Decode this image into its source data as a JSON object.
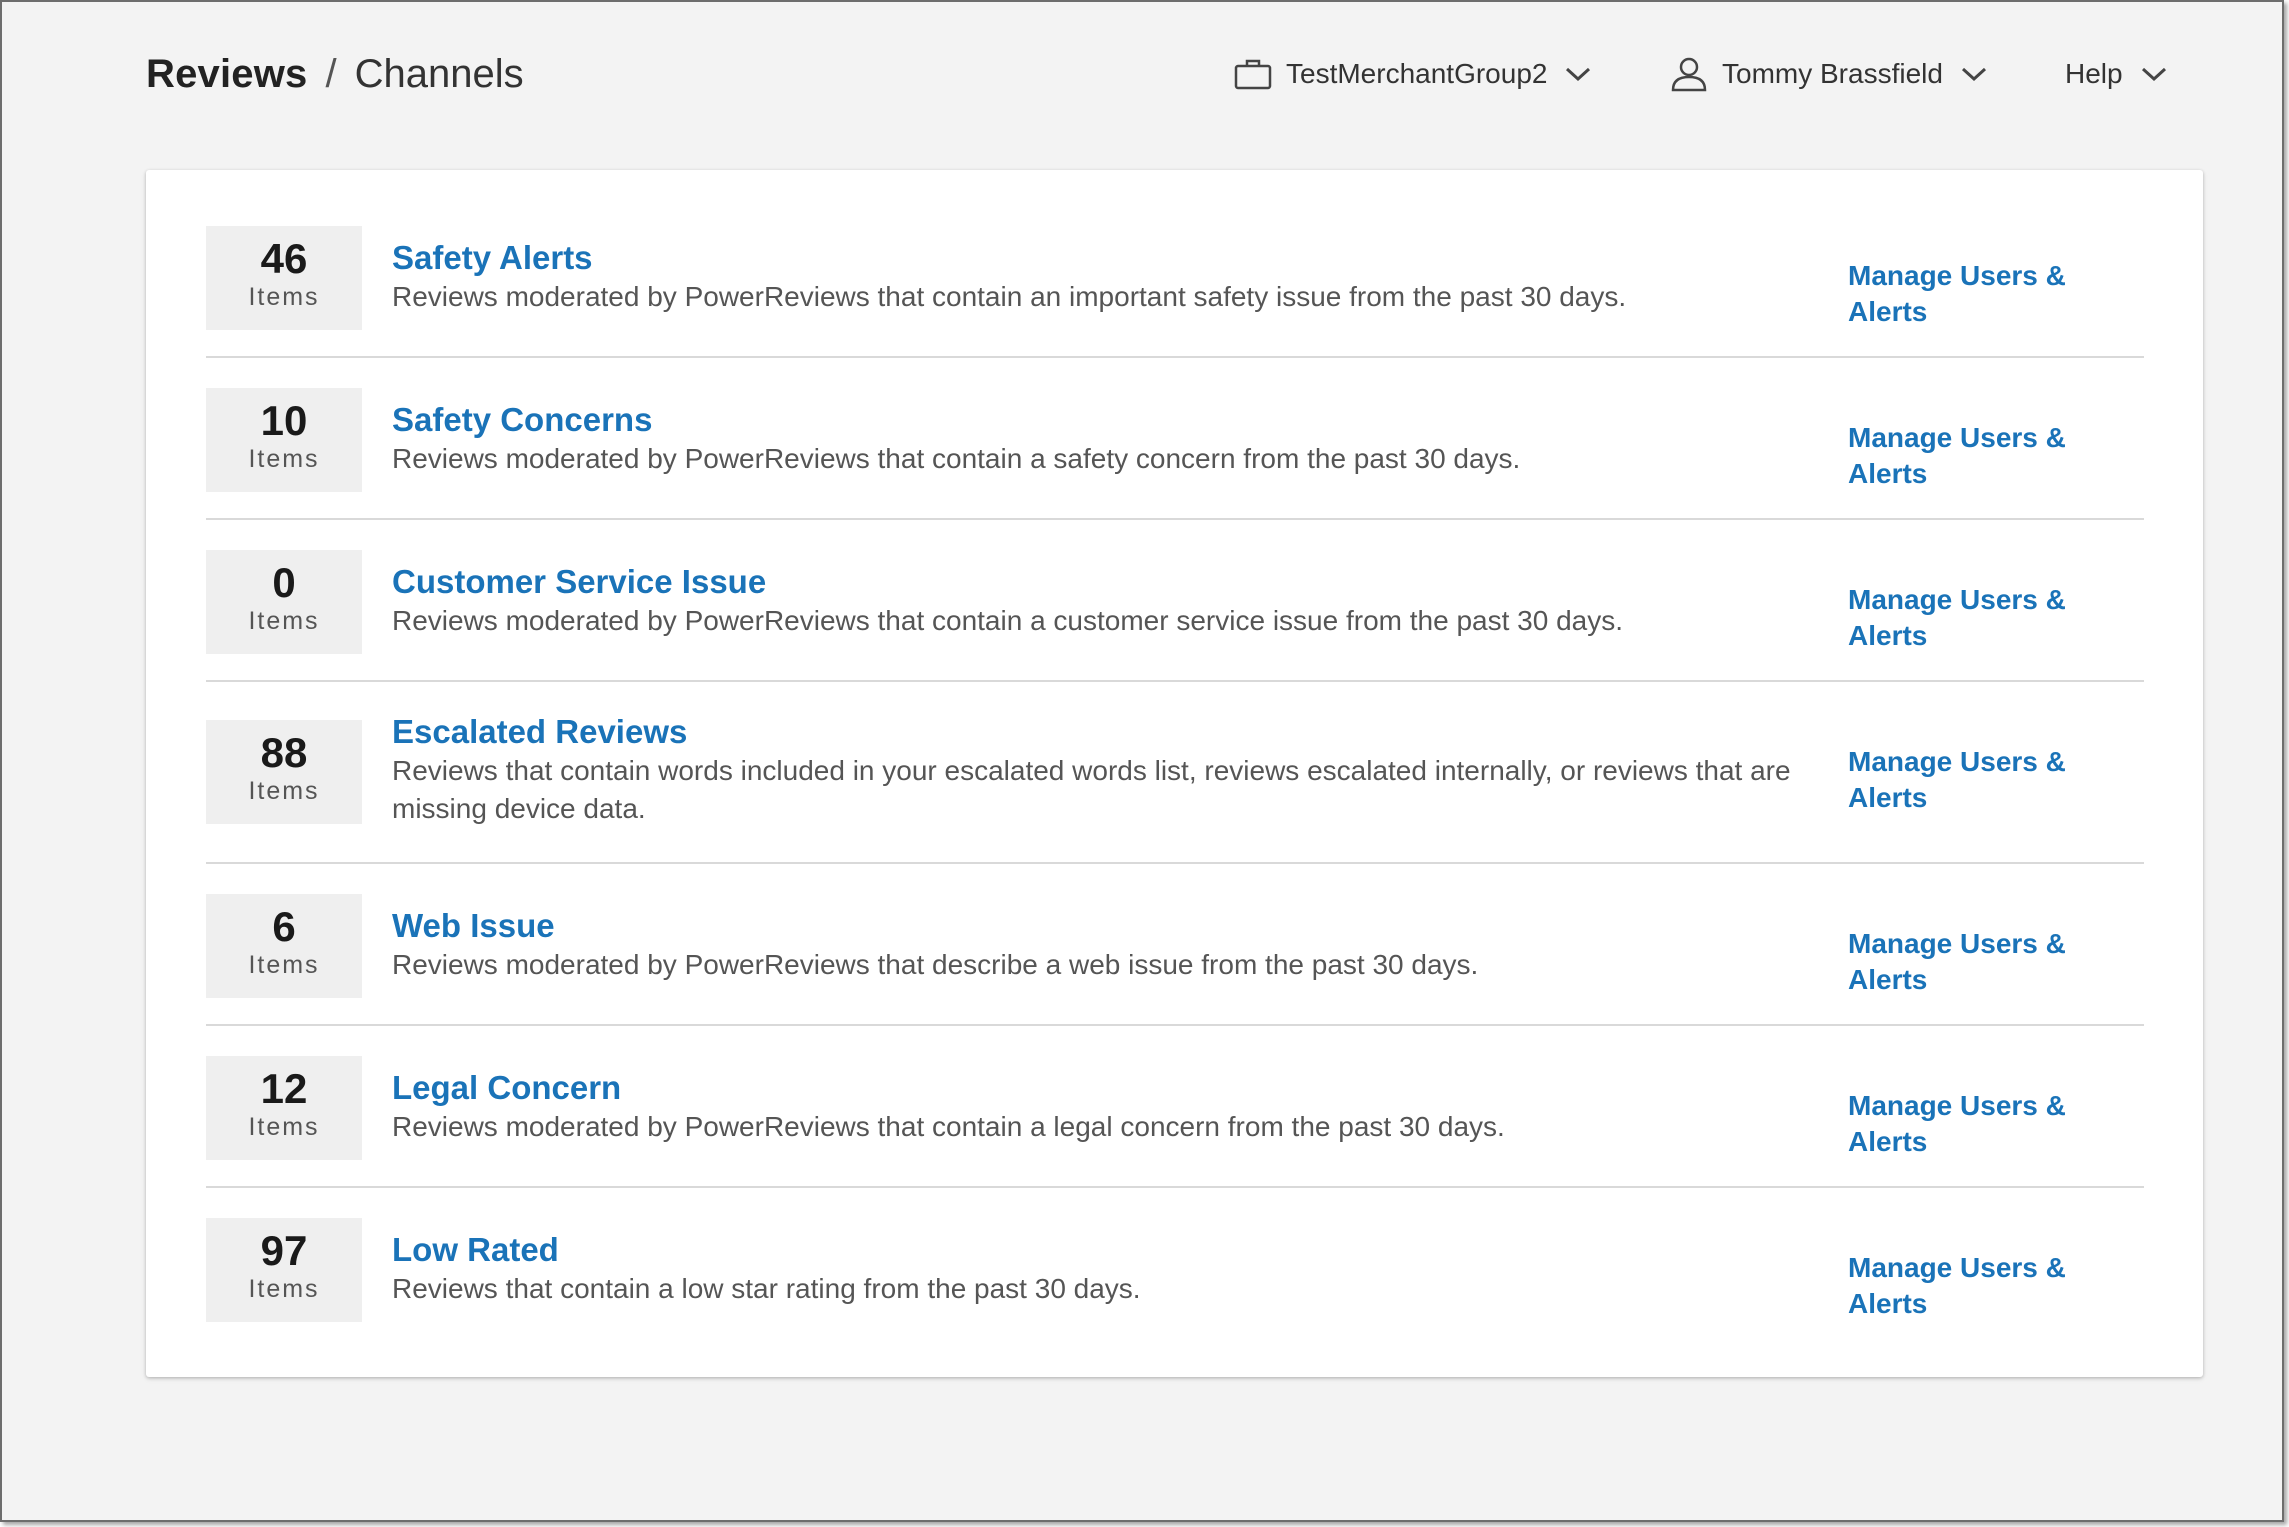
{
  "header": {
    "breadcrumb_root": "Reviews",
    "breadcrumb_sep": "/",
    "breadcrumb_current": "Channels",
    "merchant_label": "TestMerchantGroup2",
    "user_label": "Tommy Brassfield",
    "help_label": "Help",
    "icons": {
      "merchant": "briefcase-icon",
      "user": "user-icon",
      "dropdown": "chevron-down-icon"
    }
  },
  "colors": {
    "link": "#1a73b8",
    "background": "#f3f3f3",
    "count_box": "#efefef"
  },
  "channels": [
    {
      "count": "46",
      "count_label": "Items",
      "title": "Safety Alerts",
      "description": "Reviews moderated by PowerReviews that contain an important safety issue from the past 30 days.",
      "action": "Manage Users & Alerts"
    },
    {
      "count": "10",
      "count_label": "Items",
      "title": "Safety Concerns",
      "description": "Reviews moderated by PowerReviews that contain a safety concern from the past 30 days.",
      "action": "Manage Users & Alerts"
    },
    {
      "count": "0",
      "count_label": "Items",
      "title": "Customer Service Issue",
      "description": "Reviews moderated by PowerReviews that contain a customer service issue from the past 30 days.",
      "action": "Manage Users & Alerts"
    },
    {
      "count": "88",
      "count_label": "Items",
      "title": "Escalated Reviews",
      "description": "Reviews that contain words included in your escalated words list, reviews escalated internally, or reviews that are missing device data.",
      "action": "Manage Users & Alerts"
    },
    {
      "count": "6",
      "count_label": "Items",
      "title": "Web Issue",
      "description": "Reviews moderated by PowerReviews that describe a web issue from the past 30 days.",
      "action": "Manage Users & Alerts"
    },
    {
      "count": "12",
      "count_label": "Items",
      "title": "Legal Concern",
      "description": "Reviews moderated by PowerReviews that contain a legal concern from the past 30 days.",
      "action": "Manage Users & Alerts"
    },
    {
      "count": "97",
      "count_label": "Items",
      "title": "Low Rated",
      "description": "Reviews that contain a low star rating from the past 30 days.",
      "action": "Manage Users & Alerts"
    }
  ]
}
